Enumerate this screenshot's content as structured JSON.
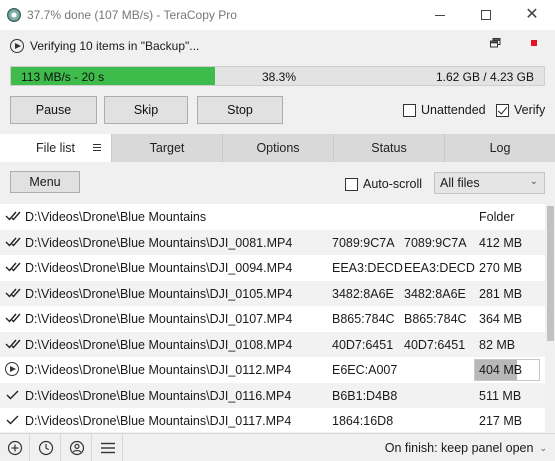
{
  "window": {
    "title": "37.7% done (107 MB/s) - TeraCopy Pro",
    "progress_fraction": 0.377
  },
  "header": {
    "status_text": "Verifying 10 items in \"Backup\"...",
    "progress": {
      "speed_text": "113 MB/s - 20 s",
      "percent_text": "38.3%",
      "size_text": "1.62 GB / 4.23 GB",
      "fill_fraction": 0.383,
      "fill_color": "#3dbb4b"
    },
    "buttons": {
      "pause": "Pause",
      "skip": "Skip",
      "stop": "Stop"
    },
    "checkboxes": {
      "unattended": {
        "label": "Unattended",
        "checked": false
      },
      "verify": {
        "label": "Verify",
        "checked": true
      }
    }
  },
  "tabs": [
    {
      "label": "File list",
      "active": true
    },
    {
      "label": "Target",
      "active": false
    },
    {
      "label": "Options",
      "active": false
    },
    {
      "label": "Status",
      "active": false
    },
    {
      "label": "Log",
      "active": false
    }
  ],
  "toolbar": {
    "menu_label": "Menu",
    "autoscroll": {
      "label": "Auto-scroll",
      "checked": false
    },
    "filter": {
      "selected": "All files"
    }
  },
  "files": [
    {
      "icon": "double-check-icon",
      "path": "D:\\Videos\\Drone\\Blue Mountains",
      "crc_source": "",
      "crc_target": "",
      "size": "Folder"
    },
    {
      "icon": "double-check-icon",
      "path": "D:\\Videos\\Drone\\Blue Mountains\\DJI_0081.MP4",
      "crc_source": "7089:9C7A",
      "crc_target": "7089:9C7A",
      "size": "412 MB"
    },
    {
      "icon": "double-check-icon",
      "path": "D:\\Videos\\Drone\\Blue Mountains\\DJI_0094.MP4",
      "crc_source": "EEA3:DECD",
      "crc_target": "EEA3:DECD",
      "size": "270 MB"
    },
    {
      "icon": "double-check-icon",
      "path": "D:\\Videos\\Drone\\Blue Mountains\\DJI_0105.MP4",
      "crc_source": "3482:8A6E",
      "crc_target": "3482:8A6E",
      "size": "281 MB"
    },
    {
      "icon": "double-check-icon",
      "path": "D:\\Videos\\Drone\\Blue Mountains\\DJI_0107.MP4",
      "crc_source": "B865:784C",
      "crc_target": "B865:784C",
      "size": "364 MB"
    },
    {
      "icon": "double-check-icon",
      "path": "D:\\Videos\\Drone\\Blue Mountains\\DJI_0108.MP4",
      "crc_source": "40D7:6451",
      "crc_target": "40D7:6451",
      "size": "82 MB"
    },
    {
      "icon": "play-circle-icon",
      "path": "D:\\Videos\\Drone\\Blue Mountains\\DJI_0112.MP4",
      "crc_source": "E6EC:A007",
      "crc_target": "",
      "size": "404 MB",
      "in_progress": true,
      "progress_fraction": 0.65
    },
    {
      "icon": "check-icon",
      "path": "D:\\Videos\\Drone\\Blue Mountains\\DJI_0116.MP4",
      "crc_source": "B6B1:D4B8",
      "crc_target": "",
      "size": "511 MB"
    },
    {
      "icon": "check-icon",
      "path": "D:\\Videos\\Drone\\Blue Mountains\\DJI_0117.MP4",
      "crc_source": "1864:16D8",
      "crc_target": "",
      "size": "217 MB"
    }
  ],
  "statusbar": {
    "on_finish": "On finish: keep panel open"
  }
}
